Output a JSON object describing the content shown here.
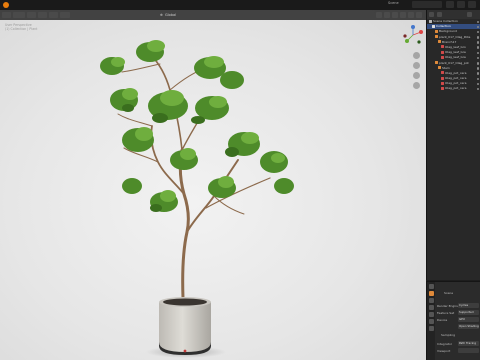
{
  "topbar": {
    "scene_label": "Scene",
    "accent": "#e87d0d"
  },
  "viewport": {
    "mode_label": "Global",
    "info_lines": [
      "User Perspective",
      "(1) Collection | Plant"
    ],
    "background": "#e6e6e6"
  },
  "outliner": {
    "rows": [
      {
        "label": "Scene Collection",
        "icon": "collection-icon",
        "color": "#bbbbbb",
        "indent": 0,
        "selected": false
      },
      {
        "label": "Collection",
        "icon": "collection-icon",
        "color": "#dddddd",
        "indent": 1,
        "selected": true
      },
      {
        "label": "Background",
        "icon": "mesh-icon",
        "color": "#e08a3a",
        "indent": 2,
        "selected": false
      },
      {
        "label": "plant_017_Olag_Pote",
        "icon": "empty-icon",
        "color": "#e08a3a",
        "indent": 2,
        "selected": false
      },
      {
        "label": "Branch17",
        "icon": "mesh-icon",
        "color": "#e08a3a",
        "indent": 3,
        "selected": false
      },
      {
        "label": "Olag_leaf_Gro",
        "icon": "material-icon",
        "color": "#d24a4a",
        "indent": 4,
        "selected": false
      },
      {
        "label": "Olag_leaf_Gre",
        "icon": "material-icon",
        "color": "#d24a4a",
        "indent": 4,
        "selected": false
      },
      {
        "label": "Olag_leaf_Gre",
        "icon": "material-icon",
        "color": "#d24a4a",
        "indent": 4,
        "selected": false
      },
      {
        "label": "plant_017_Olag_pot",
        "icon": "empty-icon",
        "color": "#e08a3a",
        "indent": 2,
        "selected": false
      },
      {
        "label": "Stem",
        "icon": "mesh-icon",
        "color": "#e08a3a",
        "indent": 3,
        "selected": false
      },
      {
        "label": "Olag_pot_cera",
        "icon": "material-icon",
        "color": "#d24a4a",
        "indent": 4,
        "selected": false
      },
      {
        "label": "Olag_pot_cera",
        "icon": "material-icon",
        "color": "#d24a4a",
        "indent": 4,
        "selected": false
      },
      {
        "label": "Olag_pot_cera",
        "icon": "material-icon",
        "color": "#d24a4a",
        "indent": 4,
        "selected": false
      },
      {
        "label": "Olag_pot_cera",
        "icon": "material-icon",
        "color": "#d24a4a",
        "indent": 4,
        "selected": false
      }
    ]
  },
  "properties": {
    "title": "Scene",
    "fields": [
      {
        "label": "Render Engine",
        "value": "Cycles"
      },
      {
        "label": "Feature Set",
        "value": "Supported"
      },
      {
        "label": "Device",
        "value": "GPU"
      },
      {
        "label": "",
        "value": "Open Shading"
      }
    ],
    "section": "Sampling",
    "sub_fields": [
      {
        "label": "Integrator",
        "value": "Path Tracing"
      },
      {
        "label": "Viewport",
        "value": ""
      }
    ]
  }
}
